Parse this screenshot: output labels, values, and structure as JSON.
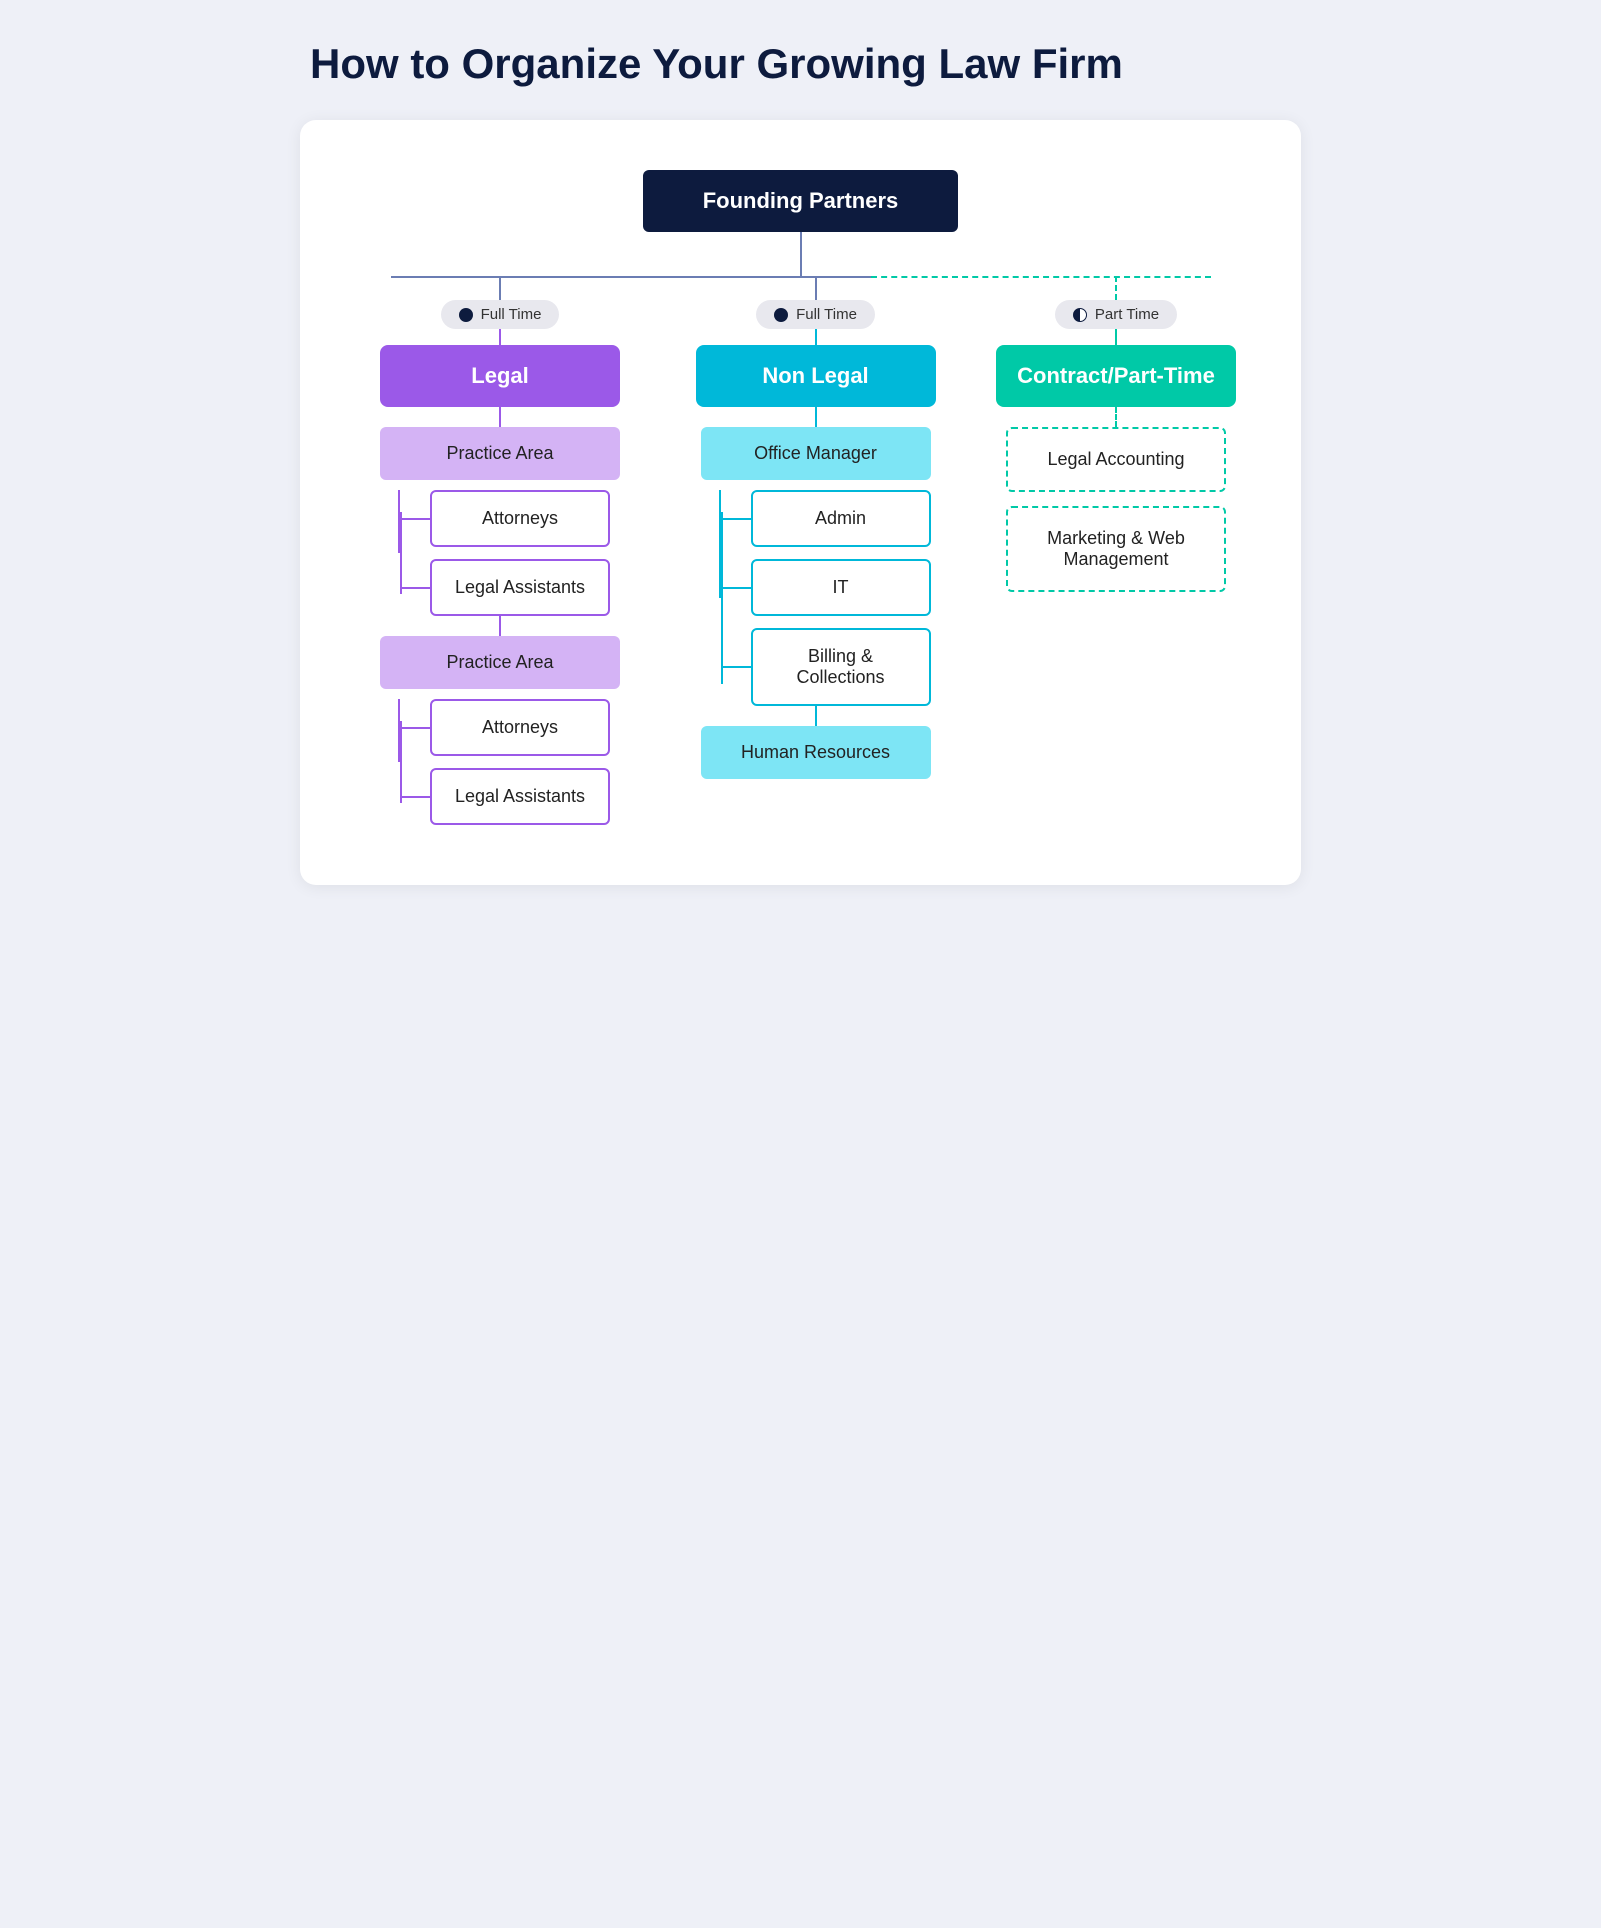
{
  "title": "How to Organize Your Growing Law Firm",
  "chart": {
    "root": {
      "label": "Founding Partners"
    },
    "columns": {
      "legal": {
        "badge": "Full Time",
        "label": "Legal",
        "practice_area_1": {
          "label": "Practice Area",
          "children": [
            {
              "label": "Attorneys"
            },
            {
              "label": "Legal Assistants"
            }
          ]
        },
        "practice_area_2": {
          "label": "Practice Area",
          "children": [
            {
              "label": "Attorneys"
            },
            {
              "label": "Legal Assistants"
            }
          ]
        }
      },
      "nonlegal": {
        "badge": "Full Time",
        "label": "Non Legal",
        "office_manager": {
          "label": "Office Manager",
          "children": [
            {
              "label": "Admin"
            },
            {
              "label": "IT"
            },
            {
              "label": "Billing & Collections"
            }
          ]
        },
        "human_resources": {
          "label": "Human Resources"
        }
      },
      "contract": {
        "badge": "Part Time",
        "label": "Contract/Part-Time",
        "items": [
          {
            "label": "Legal Accounting"
          },
          {
            "label": "Marketing & Web Management"
          }
        ]
      }
    }
  }
}
